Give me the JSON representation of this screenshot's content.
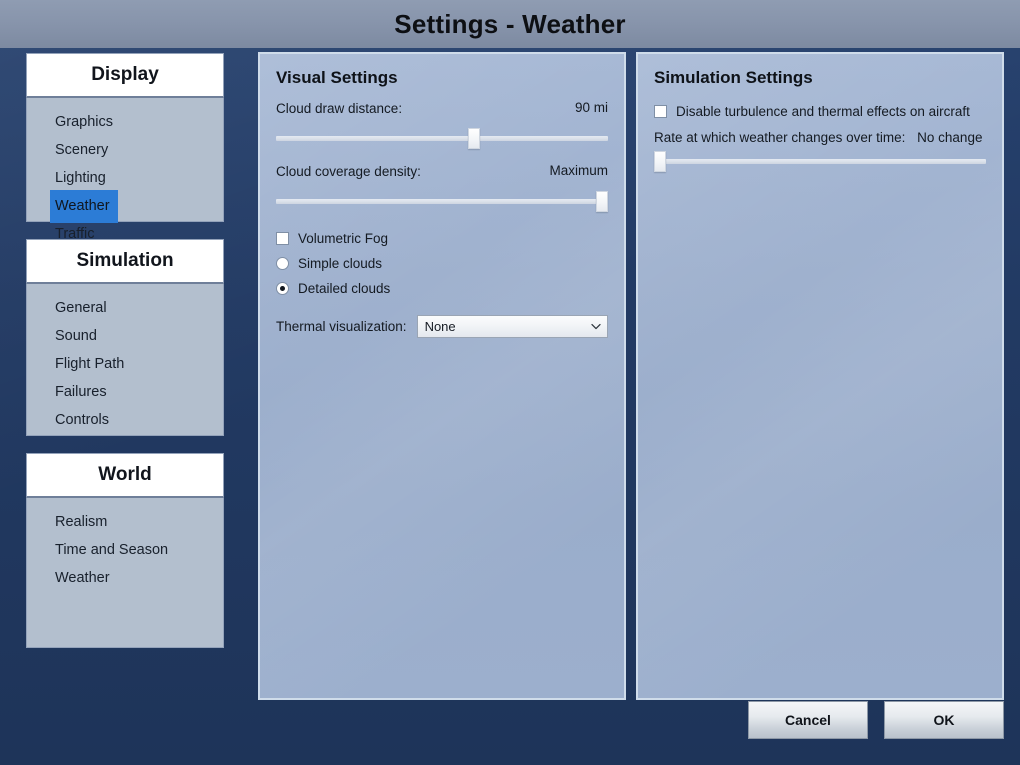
{
  "window": {
    "title": "Settings - Weather"
  },
  "sidebar": {
    "groups": [
      {
        "heading": "Display",
        "items": [
          {
            "label": "Graphics",
            "selected": false
          },
          {
            "label": "Scenery",
            "selected": false
          },
          {
            "label": "Lighting",
            "selected": false
          },
          {
            "label": "Weather",
            "selected": true
          },
          {
            "label": "Traffic",
            "selected": false
          }
        ]
      },
      {
        "heading": "Simulation",
        "items": [
          {
            "label": "General",
            "selected": false
          },
          {
            "label": "Sound",
            "selected": false
          },
          {
            "label": "Flight Path",
            "selected": false
          },
          {
            "label": "Failures",
            "selected": false
          },
          {
            "label": "Controls",
            "selected": false
          }
        ]
      },
      {
        "heading": "World",
        "items": [
          {
            "label": "Realism",
            "selected": false
          },
          {
            "label": "Time and Season",
            "selected": false
          },
          {
            "label": "Weather",
            "selected": false
          }
        ]
      }
    ]
  },
  "visual_panel": {
    "title": "Visual Settings",
    "cloud_draw_distance": {
      "label": "Cloud draw distance:",
      "value": "90 mi",
      "slider_percent": 60
    },
    "cloud_coverage_density": {
      "label": "Cloud coverage density:",
      "value": "Maximum",
      "slider_percent": 100
    },
    "volumetric_fog": {
      "label": "Volumetric Fog",
      "checked": false
    },
    "cloud_detail": {
      "simple": {
        "label": "Simple clouds",
        "selected": false
      },
      "detailed": {
        "label": "Detailed clouds",
        "selected": true
      }
    },
    "thermal_visualization": {
      "label": "Thermal visualization:",
      "value": "None",
      "chevron_icon": "chevron-down-icon"
    }
  },
  "simulation_panel": {
    "title": "Simulation Settings",
    "disable_turbulence": {
      "label": "Disable turbulence and thermal effects on aircraft",
      "checked": false
    },
    "weather_change_rate": {
      "label": "Rate at which weather changes over time:",
      "value": "No change",
      "slider_percent": 0
    }
  },
  "footer": {
    "cancel_label": "Cancel",
    "ok_label": "OK"
  },
  "colors": {
    "accent_selection": "#2c7cd6",
    "background_navy": "#223a63",
    "titlebar": "#8794ab",
    "panel": "#9fb1ce",
    "sidebar_body": "#b3bfce"
  }
}
